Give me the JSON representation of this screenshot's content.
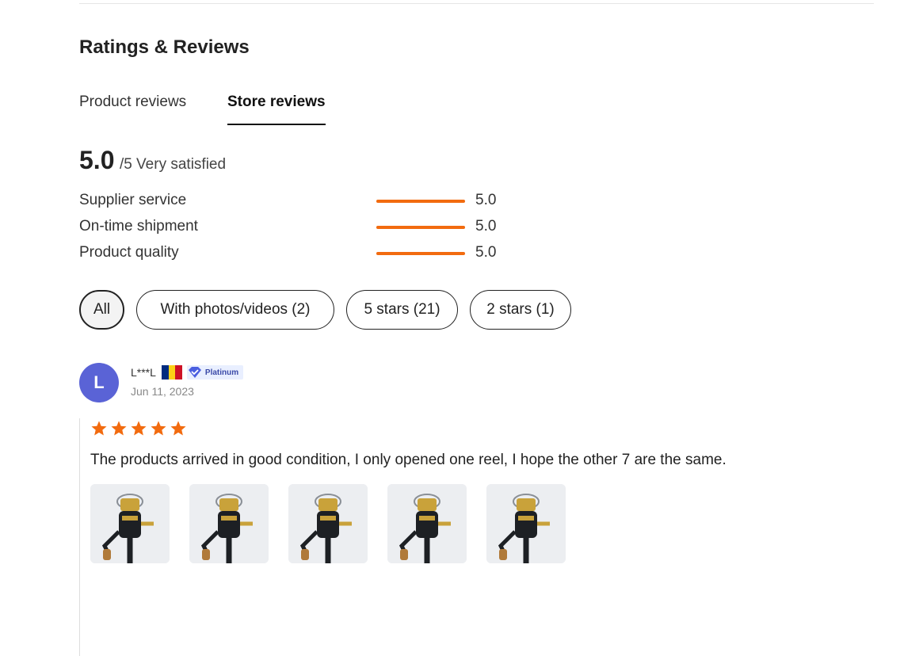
{
  "section": {
    "title": "Ratings & Reviews"
  },
  "tabs": [
    {
      "label": "Product reviews",
      "active": false
    },
    {
      "label": "Store reviews",
      "active": true
    }
  ],
  "summary": {
    "score": "5.0",
    "suffix": "/5 Very satisfied"
  },
  "metrics": [
    {
      "label": "Supplier service",
      "value": "5.0",
      "fill_fraction": 1.0
    },
    {
      "label": "On-time shipment",
      "value": "5.0",
      "fill_fraction": 1.0
    },
    {
      "label": "Product quality",
      "value": "5.0",
      "fill_fraction": 1.0
    }
  ],
  "filters": [
    {
      "label": "All",
      "active": true
    },
    {
      "label": "With photos/videos (2)",
      "active": false
    },
    {
      "label": "5 stars (21)",
      "active": false
    },
    {
      "label": "2 stars (1)",
      "active": false
    }
  ],
  "review": {
    "avatar_letter": "L",
    "avatar_color": "#5a63d6",
    "name": "L***L",
    "country_flag": [
      "#002b7f",
      "#fcd116",
      "#ce1126"
    ],
    "badge_label": "Platinum",
    "date": "Jun 11, 2023",
    "rating": 5,
    "star_color": "#f26b0f",
    "text": "The products arrived in good condition, I only opened one reel, I hope the other 7 are the same.",
    "photos": [
      "fishing-reel-photo",
      "fishing-reel-photo",
      "fishing-reel-photo",
      "fishing-reel-photo",
      "fishing-reel-photo"
    ]
  },
  "colors": {
    "accent": "#f26b0f",
    "text": "#222222"
  }
}
